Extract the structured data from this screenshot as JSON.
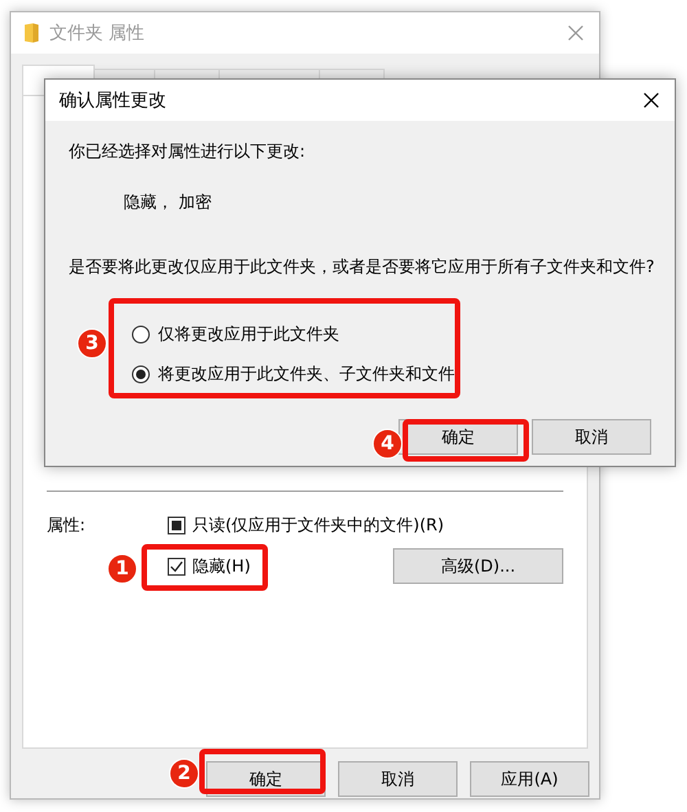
{
  "properties_window": {
    "title": "文件夹 属性",
    "tabs": [
      {
        "selected": true
      },
      {
        "selected": false
      },
      {
        "selected": false
      },
      {
        "selected": false
      },
      {
        "selected": false
      }
    ],
    "attributes_label": "属性:",
    "attributes": [
      {
        "label": "只读(仅应用于文件夹中的文件)(R)",
        "checked": false,
        "indeterminate": true
      },
      {
        "label": "隐藏(H)",
        "checked": true,
        "indeterminate": false
      }
    ],
    "advanced_button": "高级(D)...",
    "buttons": [
      "确定",
      "取消",
      "应用(A)"
    ]
  },
  "confirm_dialog": {
    "title": "确认属性更改",
    "intro": "你已经选择对属性进行以下更改:",
    "changes": "隐藏， 加密",
    "question": "是否要将此更改仅应用于此文件夹，或者是否要将它应用于所有子文件夹和文件?",
    "options": [
      {
        "label": "仅将更改应用于此文件夹",
        "selected": false
      },
      {
        "label": "将更改应用于此文件夹、子文件夹和文件",
        "selected": true
      }
    ],
    "buttons": [
      "确定",
      "取消"
    ]
  },
  "annotations": [
    {
      "number": "1"
    },
    {
      "number": "2"
    },
    {
      "number": "3"
    },
    {
      "number": "4"
    }
  ]
}
